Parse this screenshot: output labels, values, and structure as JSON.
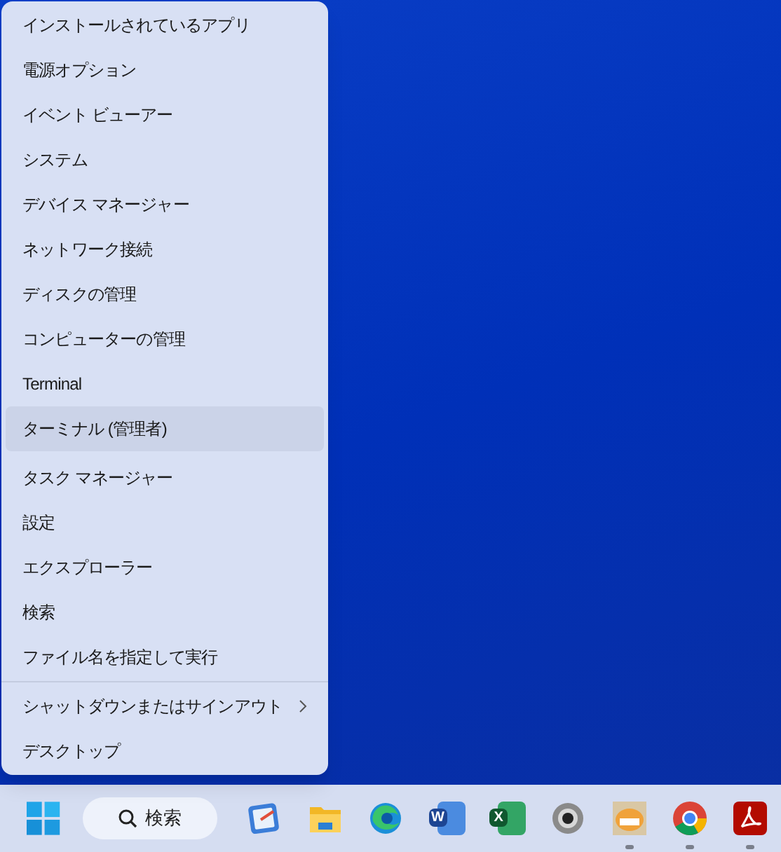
{
  "menu": {
    "groups": [
      [
        {
          "label": "インストールされているアプリ",
          "kind": "item",
          "selected": false
        },
        {
          "label": "電源オプション",
          "kind": "item",
          "selected": false
        },
        {
          "label": "イベント ビューアー",
          "kind": "item",
          "selected": false
        },
        {
          "label": "システム",
          "kind": "item",
          "selected": false
        },
        {
          "label": "デバイス マネージャー",
          "kind": "item",
          "selected": false
        },
        {
          "label": "ネットワーク接続",
          "kind": "item",
          "selected": false
        },
        {
          "label": "ディスクの管理",
          "kind": "item",
          "selected": false
        },
        {
          "label": "コンピューターの管理",
          "kind": "item",
          "selected": false
        },
        {
          "label": "Terminal",
          "kind": "item",
          "selected": false
        },
        {
          "label": "ターミナル (管理者)",
          "kind": "item",
          "selected": true
        }
      ],
      [
        {
          "label": "タスク マネージャー",
          "kind": "item",
          "selected": false
        },
        {
          "label": "設定",
          "kind": "item",
          "selected": false
        },
        {
          "label": "エクスプローラー",
          "kind": "item",
          "selected": false
        },
        {
          "label": "検索",
          "kind": "item",
          "selected": false
        },
        {
          "label": "ファイル名を指定して実行",
          "kind": "item",
          "selected": false
        }
      ],
      [
        {
          "label": "シャットダウンまたはサインアウト",
          "kind": "submenu",
          "selected": false
        },
        {
          "label": "デスクトップ",
          "kind": "item",
          "selected": false
        }
      ]
    ]
  },
  "taskbar": {
    "search": {
      "label": "検索"
    },
    "apps": [
      {
        "kind": "remote",
        "running": false
      },
      {
        "kind": "folder",
        "running": false
      },
      {
        "kind": "edge",
        "running": false
      },
      {
        "kind": "word",
        "label": "W",
        "running": false
      },
      {
        "kind": "excel",
        "label": "X",
        "running": false
      },
      {
        "kind": "webcam",
        "running": false
      },
      {
        "kind": "cartoon",
        "running": true
      },
      {
        "kind": "chrome",
        "running": true
      },
      {
        "kind": "pdf",
        "running": true
      }
    ]
  }
}
